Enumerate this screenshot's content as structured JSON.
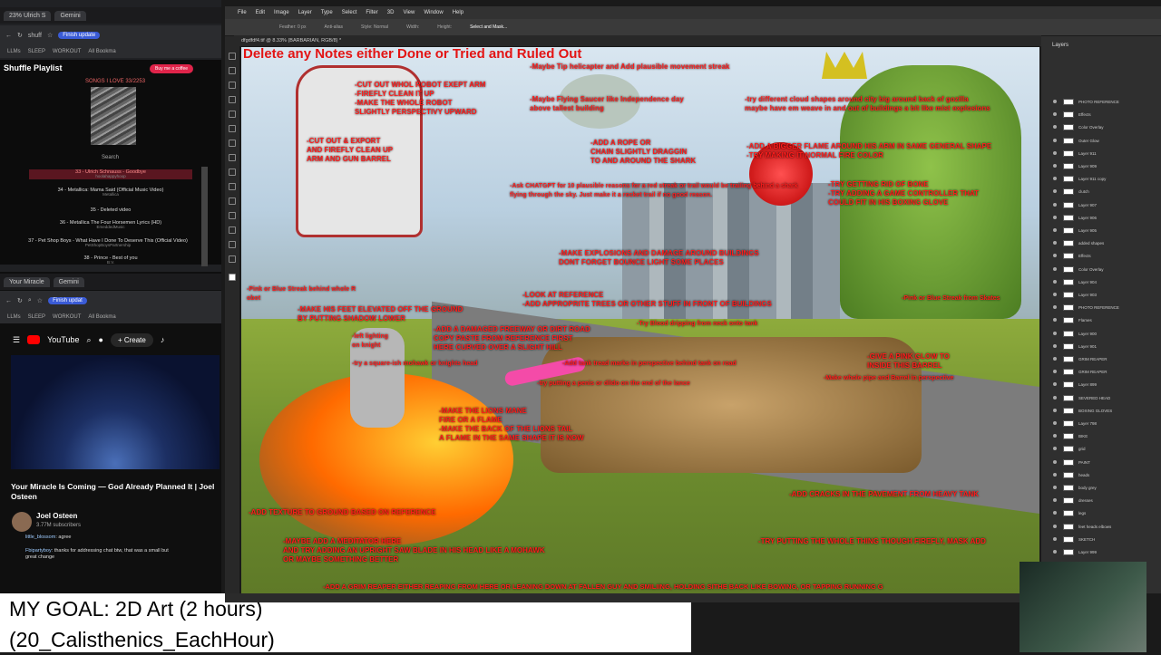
{
  "browser1": {
    "tabs": [
      "23% Ulrich S",
      "Gemini"
    ],
    "address": "shuff",
    "finish_update": "Finish update",
    "bookmarks": [
      "LLMs",
      "SLEEP",
      "WORKOUT",
      "All Bookma"
    ],
    "playlist_title": "Shuffle Playlist",
    "buy_coffee": "Buy me a coffee",
    "songs_heading": "SONGS I LOVE  33/2253",
    "search_label": "Search",
    "songs": [
      {
        "title": "33 - Ulrich Schnauss - Goodbye",
        "sub": "hoolahappyhoop",
        "active": true
      },
      {
        "title": "34 - Metallica: Mama Said (Official Music Video)",
        "sub": "Metallica",
        "active": false
      },
      {
        "title": "35 - Deleted video",
        "sub": "",
        "active": false
      },
      {
        "title": "36 - Metallica The Four Horsemen Lyrics (HD)",
        "sub": "EmeddedMusic",
        "active": false
      },
      {
        "title": "37 - Pet Shop Boys - What Have I Done To Deserve This (Official Video)",
        "sub": "PetShopBoysPartnership",
        "active": false
      },
      {
        "title": "38 - Prince - Best of you",
        "sub": "B.V.",
        "active": false
      }
    ]
  },
  "browser2": {
    "tabs": [
      "Your Miracle",
      "Gemini"
    ],
    "finish_update": "Finish updat",
    "bookmarks": [
      "LLMs",
      "SLEEP",
      "WORKOUT",
      "All Bookma"
    ],
    "youtube": "YouTube",
    "create": "Create",
    "video_title": "Your Miracle Is Coming — God Already Planned It | Joel Osteen",
    "channel": "Joel Osteen",
    "subscribers": "3.77M subscribers",
    "chat": [
      {
        "user": "little_blossom",
        "text": "agree"
      },
      {
        "user": "Fbipartyboy",
        "text": "thanks for addressing chat btw, that was a small but great change"
      }
    ]
  },
  "goal": {
    "line1": "MY GOAL: 2D Art (2 hours)",
    "line2": "(20_Calisthenics_EachHour)"
  },
  "photoshop": {
    "menu": [
      "File",
      "Edit",
      "Image",
      "Layer",
      "Type",
      "Select",
      "Filter",
      "3D",
      "View",
      "Window",
      "Help"
    ],
    "options": [
      "Feather: 0 px",
      "Anti-alias",
      "Style: Normal",
      "Width:",
      "Height:",
      "Select and Mask..."
    ],
    "doc_tab": "dfgdfdf4.tif @ 8.33% (BARBARIAN, RGB/8) *",
    "layers_title": "Layers",
    "layers": [
      "PHOTO REFERENCE",
      "Effects",
      "Color Overlay",
      "Outer Glow",
      "Layer 911",
      "Layer 909",
      "Layer 911 copy",
      "clutch",
      "Layer 907",
      "Layer 906",
      "Layer 905",
      "added shapes",
      "Effects",
      "Color Overlay",
      "Layer 904",
      "Layer 903",
      "PHOTO REFERENCE",
      "Flames",
      "Layer 900",
      "Layer 901",
      "GRIM REAPER",
      "GRIM REAPER",
      "Layer 899",
      "SEVERED HEAD",
      "BOXING GLOVES",
      "Layer 798",
      "BIKE",
      "grid",
      "PAINT",
      "heads",
      "body grey",
      "dresses",
      "legs",
      "feet heads elbows",
      "SKETCH",
      "Layer 999"
    ]
  },
  "notes": {
    "headline": "Delete any Notes either Done or Tried and Ruled Out",
    "n1": "-Maybe Tip helicapter and Add plausible movement streak",
    "n2": "-CUT OUT WHOL ROBOT EXEPT ARM",
    "n3": "-FIREFLY CLEAN IT UP",
    "n4": "-MAKE THE WHOLE ROBOT",
    "n5": "SLIGHTLY PERSPECTIVY UPWARD",
    "n6": "-Maybe Flying Saucer like Independence day",
    "n7": "above tallest building",
    "n8": "-try different cloud shapes around city big around back of gozilla",
    "n9": "maybe have em weave in and out of buildings a bit like mist explosions",
    "n10": "-CUT OUT & EXPORT",
    "n11": "AND FIREFLY CLEAN UP",
    "n12": "ARM AND GUN BARREL",
    "n13": "-ADD A ROPE OR",
    "n14": "CHAIN SLIGHTLY DRAGGIN",
    "n15": "TO AND AROUND THE SHARK",
    "n16": "-ADD A BIGGER FLAME AROUND HIS ARM IN SAME GENERAL SHAPE",
    "n17": "-TRY MAKING IT NORMAL FIRE COLOR",
    "n18": "-Ask CHATGPT for 10 plausible reasons for a red streak or trail would be trailing behind a shark",
    "n19": "flying through the sky. Just make it a rocket trail if no good reason.",
    "n20": "-TRY GETTING RID OF BONE",
    "n21": "-TRY ADDING A GAME CONTROLLER THAT",
    "n22": "COULD FIT IN HIS BOXING GLOVE",
    "n23": "-MAKE EXPLOSIONS AND DAMAGE AROUND BUILDINGS",
    "n24": "DONT FORGET BOUNCE LIGHT SOME PLACES",
    "n25": "-Pink or Blue Streak behind whole R",
    "n26": "obot",
    "n27": "-LOOK AT REFERENCE",
    "n28": "-ADD APPROPRITE TREES OR OTHER STUFF IN FRONT OF BUILDINGS",
    "n29": "-Pink or Blue Streak from Skates",
    "n30": "-MAKE HIS FEET ELEVATED OFF THE GROUND",
    "n31": "BY PUTTING SHADOW LOWER",
    "n32": "-ADD A DAMAGED FREEWAY OR DIRT ROAD",
    "n33": "COPY PASTE FROM REFERENCE FIRST",
    "n34": "HERE CURVED OVER A SLIGHT HILL",
    "n35": "-Try Blood dripping from neck onto tank",
    "n36": "-left lighting",
    "n37": "on knight",
    "n38": "-try a square-ish mohawk or knights head",
    "n39": "-Add tank tread marks in perspective behind tank on road",
    "n40": "-GIVE A PINK GLOW TO",
    "n41": "INSIDE THIS BARREL",
    "n42": "-Make whole pipe and Barrel in perspective",
    "n43": "-try putting a penis or dildo on the end of the lance",
    "n44": "-MAKE THE LIONS MANE",
    "n45": "FIRE OR A FLAME",
    "n46": "-MAKE THE BACK OF THE LIONS TAIL",
    "n47": "A FLAME IN THE SAME SHAPE IT IS NOW",
    "n48": "-ADD CRACKS IN THE PAVEMENT FROM HEAVY TANK",
    "n49": "-ADD TEXTURE TO GROUND BASED ON REFERENCE",
    "n50": "-MAYBE ADD A MEDITATOR HERE",
    "n51": "AND TRY ADDING AN UPRIGHT SAW BLADE IN HIS HEAD LIKE A MOHAWK",
    "n52": "OR MAYBE SOMETHING BETTER",
    "n53": "-TRY PUTTING THE WHOLE THING THOUGH FIREFLY, MASK ADD",
    "n54": "-ADD A GRIM REAPER EITHER REAPING FROM HERE OR LEANING DOWN AT FALLEN GUY AND SMILIING, HOLDING SITHE BACK LIKE BOWING, OR TAPPING RUNNING G"
  }
}
